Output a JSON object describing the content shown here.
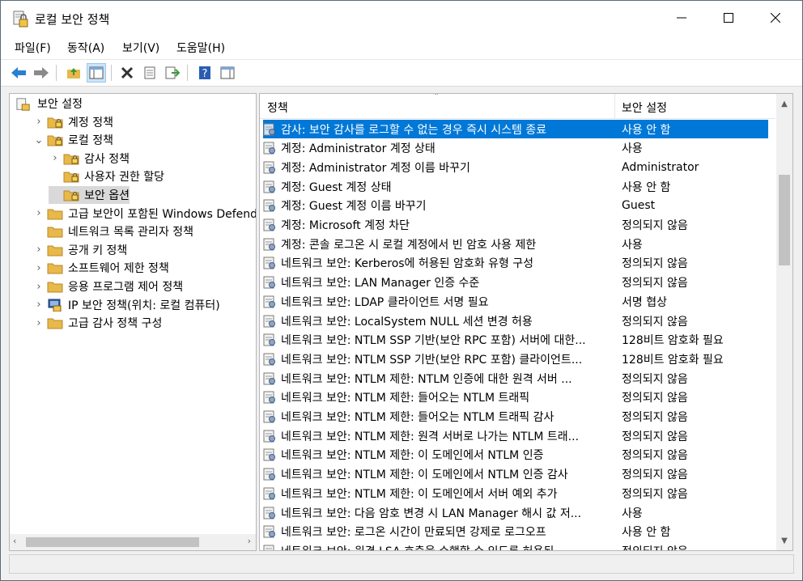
{
  "window": {
    "title": "로컬 보안 정책"
  },
  "menu": [
    "파일(F)",
    "동작(A)",
    "보기(V)",
    "도움말(H)"
  ],
  "tree": [
    {
      "label": "보안 설정",
      "expander": "",
      "indent": 0
    },
    {
      "label": "계정 정책",
      "expander": "›",
      "indent": 1
    },
    {
      "label": "로컬 정책",
      "expander": "⌄",
      "indent": 1
    },
    {
      "label": "감사 정책",
      "expander": "›",
      "indent": 2
    },
    {
      "label": "사용자 권한 할당",
      "expander": "",
      "indent": 2
    },
    {
      "label": "보안 옵션",
      "expander": "",
      "indent": 2,
      "selected": true
    },
    {
      "label": "고급 보안이 포함된 Windows Defender",
      "expander": "›",
      "indent": 1
    },
    {
      "label": "네트워크 목록 관리자 정책",
      "expander": "",
      "indent": 1
    },
    {
      "label": "공개 키 정책",
      "expander": "›",
      "indent": 1
    },
    {
      "label": "소프트웨어 제한 정책",
      "expander": "›",
      "indent": 1
    },
    {
      "label": "응용 프로그램 제어 정책",
      "expander": "›",
      "indent": 1
    },
    {
      "label": "IP 보안 정책(위치: 로컬 컴퓨터)",
      "expander": "›",
      "indent": 1,
      "icon": "ip-security-icon"
    },
    {
      "label": "고급 감사 정책 구성",
      "expander": "›",
      "indent": 1
    }
  ],
  "list": {
    "headers": {
      "policy": "정책",
      "setting": "보안 설정"
    },
    "rows": [
      {
        "policy": "감사: 보안 감사를 로그할 수 없는 경우 즉시 시스템 종료",
        "setting": "사용 안 함",
        "selected": true
      },
      {
        "policy": "계정: Administrator 계정 상태",
        "setting": "사용"
      },
      {
        "policy": "계정: Administrator 계정 이름 바꾸기",
        "setting": "Administrator"
      },
      {
        "policy": "계정: Guest 계정 상태",
        "setting": "사용 안 함"
      },
      {
        "policy": "계정: Guest 계정 이름 바꾸기",
        "setting": "Guest"
      },
      {
        "policy": "계정: Microsoft 계정 차단",
        "setting": "정의되지 않음"
      },
      {
        "policy": "계정: 콘솔 로그온 시 로컬 계정에서 빈 암호 사용 제한",
        "setting": "사용"
      },
      {
        "policy": "네트워크 보안: Kerberos에 허용된 암호화 유형 구성",
        "setting": "정의되지 않음"
      },
      {
        "policy": "네트워크 보안: LAN Manager 인증 수준",
        "setting": "정의되지 않음"
      },
      {
        "policy": "네트워크 보안: LDAP 클라이언트 서명 필요",
        "setting": "서명 협상"
      },
      {
        "policy": "네트워크 보안: LocalSystem NULL 세션 변경 허용",
        "setting": "정의되지 않음"
      },
      {
        "policy": "네트워크 보안: NTLM SSP 기반(보안 RPC 포함) 서버에 대한...",
        "setting": "128비트 암호화 필요"
      },
      {
        "policy": "네트워크 보안: NTLM SSP 기반(보안 RPC 포함) 클라이언트...",
        "setting": "128비트 암호화 필요"
      },
      {
        "policy": "네트워크 보안: NTLM 제한: NTLM 인증에 대한 원격 서버 ...",
        "setting": "정의되지 않음"
      },
      {
        "policy": "네트워크 보안: NTLM 제한: 들어오는 NTLM 트래픽",
        "setting": "정의되지 않음"
      },
      {
        "policy": "네트워크 보안: NTLM 제한: 들어오는 NTLM 트래픽 감사",
        "setting": "정의되지 않음"
      },
      {
        "policy": "네트워크 보안: NTLM 제한: 원격 서버로 나가는 NTLM 트래...",
        "setting": "정의되지 않음"
      },
      {
        "policy": "네트워크 보안: NTLM 제한: 이 도메인에서 NTLM 인증",
        "setting": "정의되지 않음"
      },
      {
        "policy": "네트워크 보안: NTLM 제한: 이 도메인에서 NTLM 인증 감사",
        "setting": "정의되지 않음"
      },
      {
        "policy": "네트워크 보안: NTLM 제한: 이 도메인에서 서버 예외 추가",
        "setting": "정의되지 않음"
      },
      {
        "policy": "네트워크 보안: 다음 암호 변경 시 LAN Manager 해시 값 저...",
        "setting": "사용"
      },
      {
        "policy": "네트워크 보안: 로그온 시간이 만료되면 강제로 로그오프",
        "setting": "사용 안 함"
      },
      {
        "policy": "네트워크 보안: 원격 LSA 호출을 수행할 수 있도록 허용된 ...",
        "setting": "정의되지 않음"
      }
    ]
  },
  "colors": {
    "selection": "#0078d7",
    "folder": "#e8b84a"
  }
}
